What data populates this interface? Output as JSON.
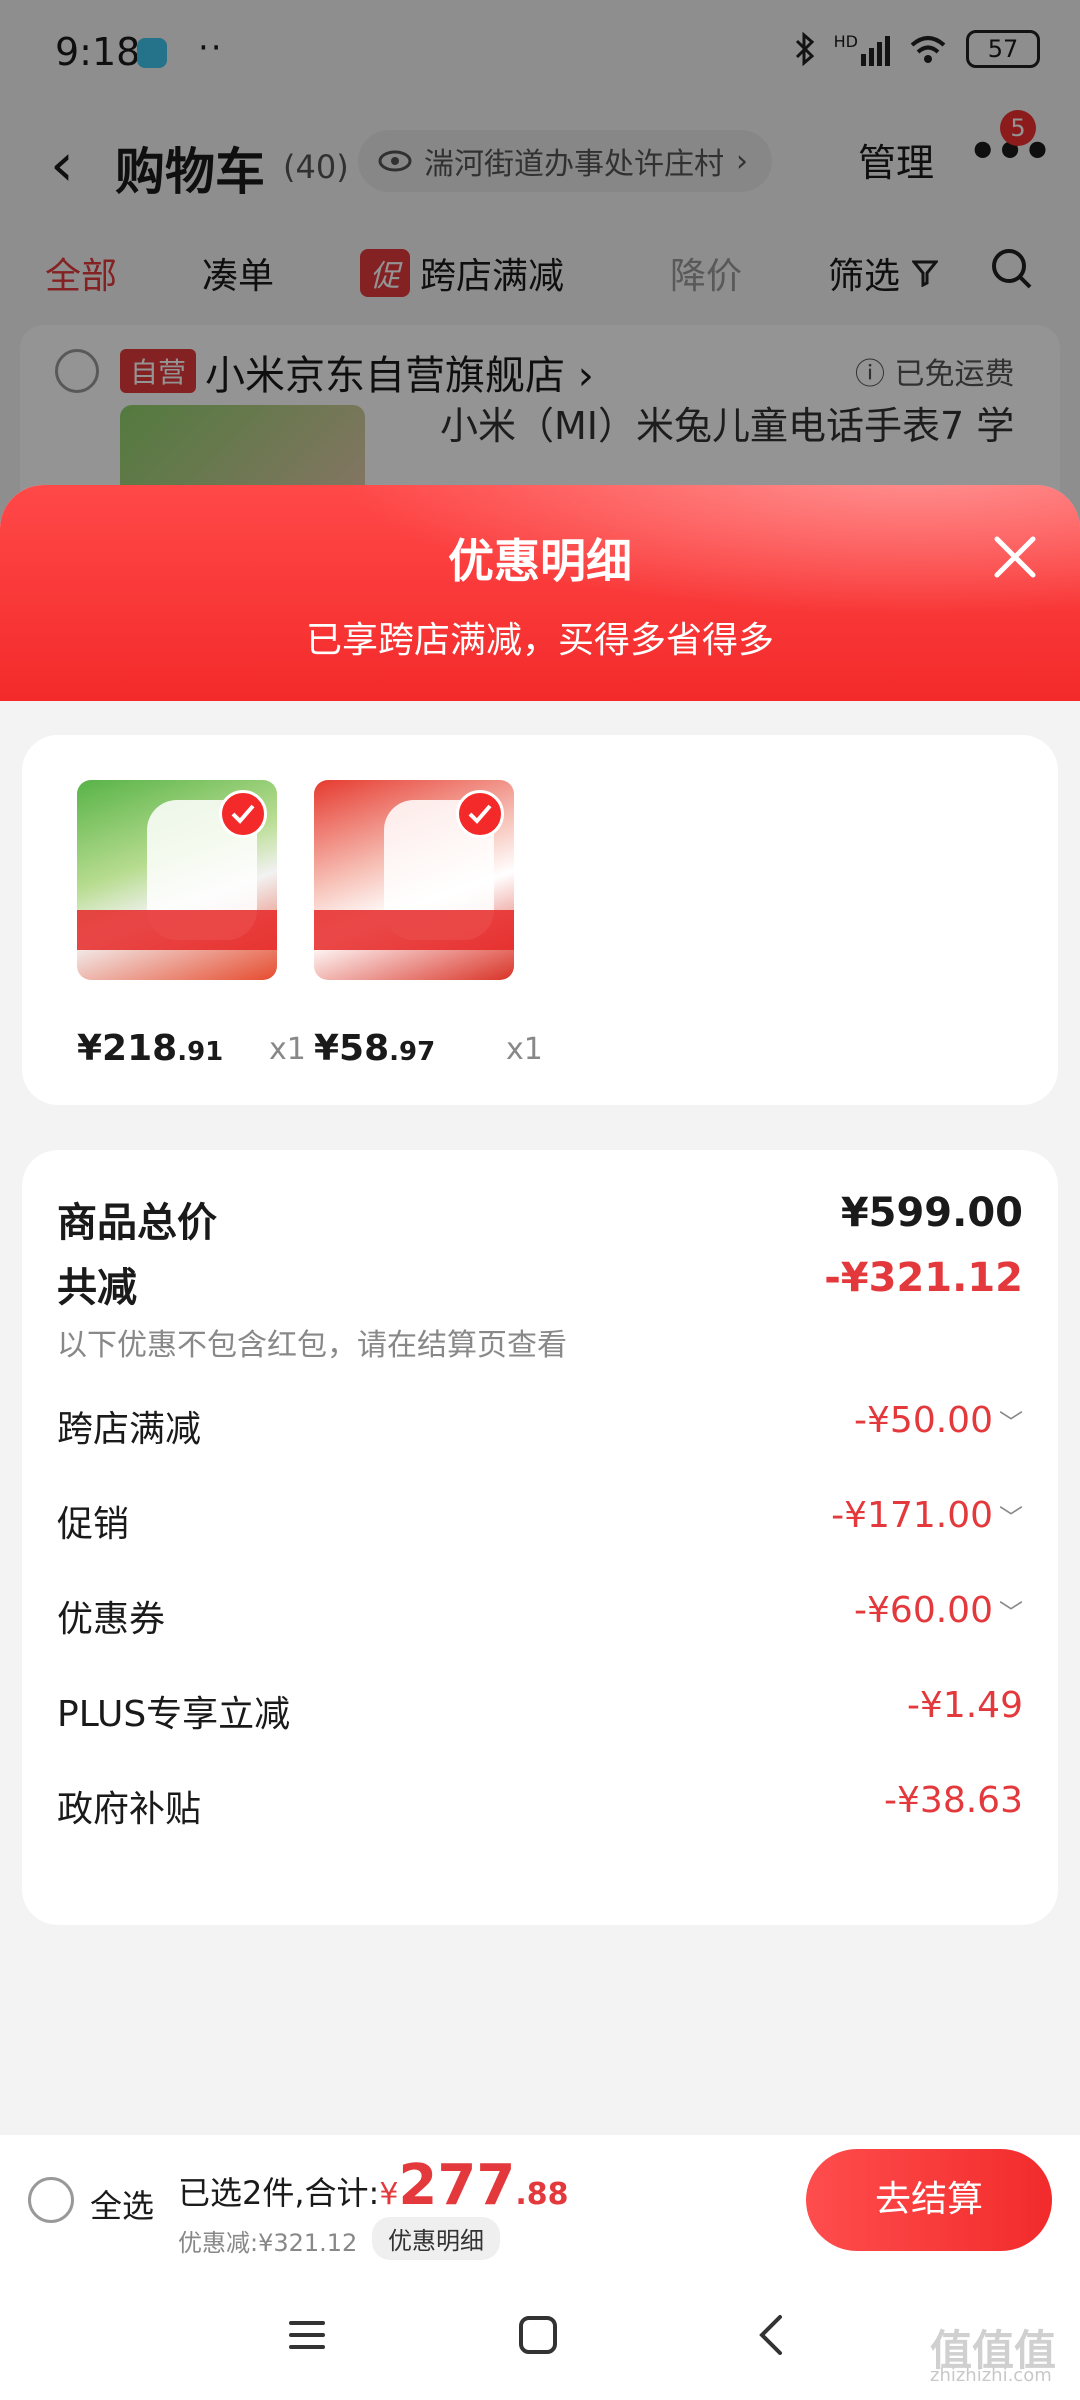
{
  "status_bar": {
    "time": "9:18",
    "more": "··",
    "battery": "57",
    "net": "HD"
  },
  "header": {
    "back": "‹",
    "title": "购物车",
    "count": "(40)",
    "address": "湍河街道办事处许庄村",
    "address_arrow": "›",
    "manage": "管理",
    "more": "•••",
    "notif_badge": "5"
  },
  "filters": {
    "all": "全部",
    "cou_dan": "凑单",
    "promo_tag": "促",
    "cross_store": "跨店满减",
    "price_drop": "降价",
    "filter": "筛选"
  },
  "store": {
    "tag": "自营",
    "name": "小米京东自营旗舰店 ›",
    "shipping": "已免运费",
    "product_title": "小米（MI）米兔儿童电话手表7 学"
  },
  "sheet": {
    "title": "优惠明细",
    "subtitle": "已享跨店满减，买得多省得多"
  },
  "items": [
    {
      "price_int": "¥218",
      "price_dec": ".91",
      "qty": "x1"
    },
    {
      "price_int": "¥58",
      "price_dec": ".97",
      "qty": "x1"
    }
  ],
  "details": {
    "total_label": "商品总价",
    "total_value": "¥599.00",
    "reduce_label": "共减",
    "reduce_value": "-¥321.12",
    "note": "以下优惠不包含红包，请在结算页查看",
    "rows": [
      {
        "label": "跨店满减",
        "value": "-¥50.00",
        "expandable": true
      },
      {
        "label": "促销",
        "value": "-¥171.00",
        "expandable": true
      },
      {
        "label": "优惠券",
        "value": "-¥60.00",
        "expandable": true
      },
      {
        "label": "PLUS专享立减",
        "value": "-¥1.49",
        "expandable": false
      },
      {
        "label": "政府补贴",
        "value": "-¥38.63",
        "expandable": false
      }
    ],
    "chevron": "﹀"
  },
  "checkout": {
    "select_all": "全选",
    "summary_prefix": "已选2件,合计:",
    "yen": "¥",
    "total_int": "277",
    "total_dec": ".88",
    "saved": "优惠减:¥321.12",
    "detail_pill": "优惠明细",
    "button": "去结算"
  },
  "watermark": {
    "main": "值值值",
    "sub": "zhizhizhi.com"
  },
  "colors": {
    "accent": "#e4393c",
    "sheet_header": "#f42a2a"
  }
}
